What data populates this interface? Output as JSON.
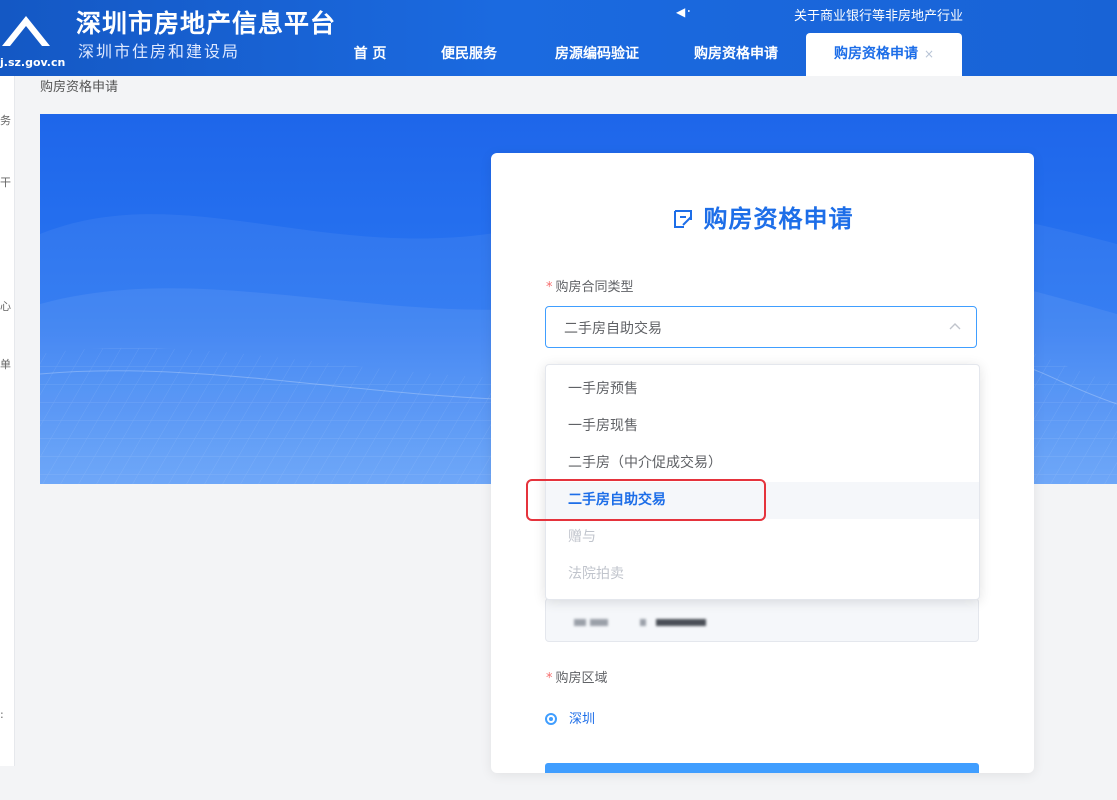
{
  "header": {
    "domain": "j.sz.gov.cn",
    "title": "深圳市房地产信息平台",
    "subtitle": "深圳市住房和建设局",
    "notice": "关于商业银行等非房地产行业"
  },
  "nav": [
    {
      "label": "首 页",
      "width": 80
    },
    {
      "label": "便民服务",
      "width": 118
    },
    {
      "label": "房源编码验证",
      "width": 138
    },
    {
      "label": "购房资格申请",
      "width": 140
    },
    {
      "label": "购房资格申请",
      "width": 156,
      "active": true,
      "close": "×"
    }
  ],
  "sidebar_chars": [
    "务",
    "干",
    "心",
    "单",
    ":"
  ],
  "breadcrumb": "购房资格申请",
  "form": {
    "title": "购房资格申请",
    "required_mark": "*",
    "contract_type_label": "购房合同类型",
    "contract_type_value": "二手房自助交易",
    "region_label": "购房区域",
    "region_value": "深圳"
  },
  "dropdown": {
    "options": [
      {
        "label": "一手房预售",
        "state": "normal"
      },
      {
        "label": "一手房现售",
        "state": "normal"
      },
      {
        "label": "二手房（中介促成交易）",
        "state": "normal"
      },
      {
        "label": "二手房自助交易",
        "state": "selected"
      },
      {
        "label": "赠与",
        "state": "disabled"
      },
      {
        "label": "法院拍卖",
        "state": "disabled"
      }
    ]
  },
  "colors": {
    "primary": "#1d6ee8",
    "header_bg": "#1863d6",
    "highlight": "#e5333c"
  }
}
